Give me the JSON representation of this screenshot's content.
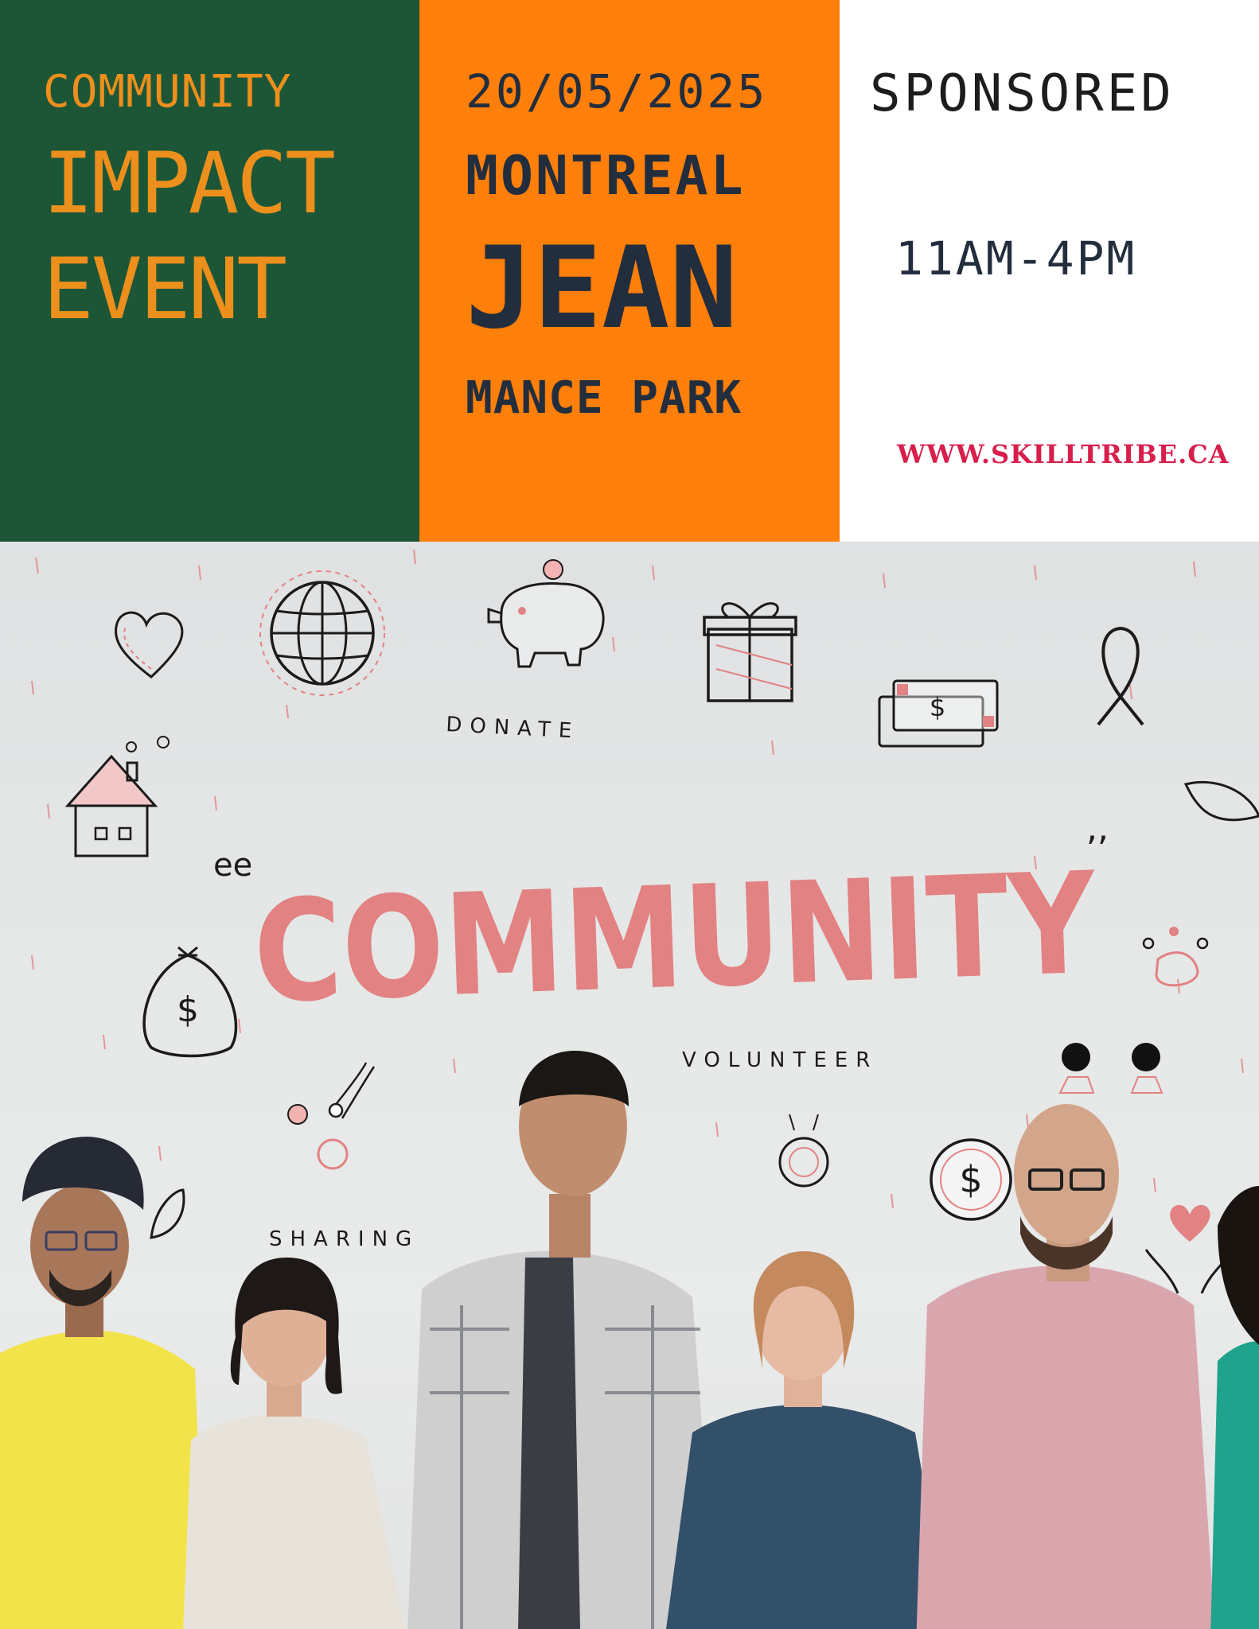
{
  "left_panel": {
    "line1": "COMMUNITY",
    "line2": "IMPACT",
    "line3": "EVENT"
  },
  "middle_panel": {
    "date": "20/05/2025",
    "city": "MONTREAL",
    "venue_big": "JEAN",
    "venue_rest": "MANCE PARK"
  },
  "right_panel": {
    "sponsored": "SPONSORED",
    "time": "11AM-4PM",
    "website": "WWW.SKILLTRIBE.CA"
  },
  "photo": {
    "headline": "COMMUNITY",
    "word_donate": "DONATE",
    "word_volunteer": "VOLUNTEER",
    "word_sharing": "SHARING",
    "dollar_sign": "$"
  },
  "colors": {
    "green": "#1d5636",
    "orange": "#fe7f0a",
    "accent_orange_text": "#ed8f1c",
    "navy": "#222d3d",
    "website_pink": "#d81e4b",
    "doodle_pink": "#e28282"
  }
}
